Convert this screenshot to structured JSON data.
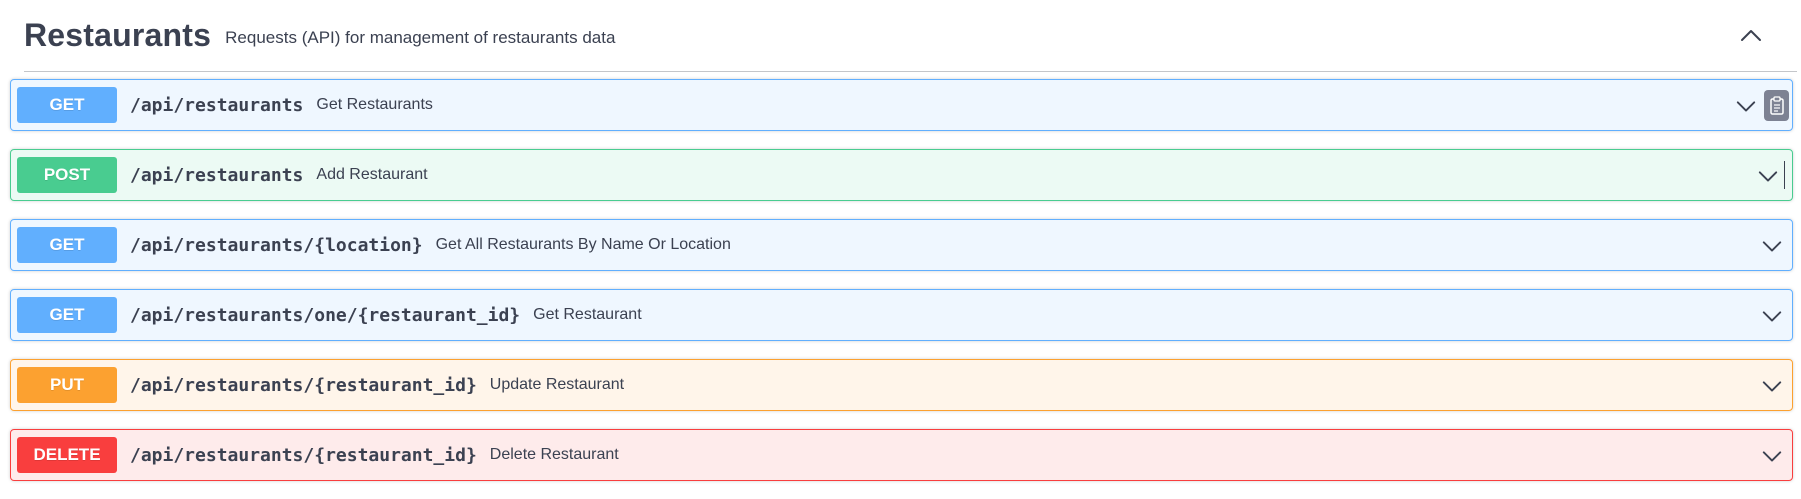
{
  "tag": {
    "title": "Restaurants",
    "description": "Requests (API) for management of restaurants data",
    "collapse_icon": "chevron-up-icon"
  },
  "operations": [
    {
      "method": "GET",
      "path": "/api/restaurants",
      "summary": "Get Restaurants",
      "color": "#61affe"
    },
    {
      "method": "POST",
      "path": "/api/restaurants",
      "summary": "Add Restaurant",
      "color": "#49cc90"
    },
    {
      "method": "GET",
      "path": "/api/restaurants/{location}",
      "summary": "Get All Restaurants By Name Or Location",
      "color": "#61affe"
    },
    {
      "method": "GET",
      "path": "/api/restaurants/one/{restaurant_id}",
      "summary": "Get Restaurant",
      "color": "#61affe"
    },
    {
      "method": "PUT",
      "path": "/api/restaurants/{restaurant_id}",
      "summary": "Update Restaurant",
      "color": "#fca130"
    },
    {
      "method": "DELETE",
      "path": "/api/restaurants/{restaurant_id}",
      "summary": "Delete Restaurant",
      "color": "#f93e3e"
    }
  ],
  "icons": {
    "expand": "chevron-down-icon",
    "copy": "clipboard-copy-icon"
  }
}
